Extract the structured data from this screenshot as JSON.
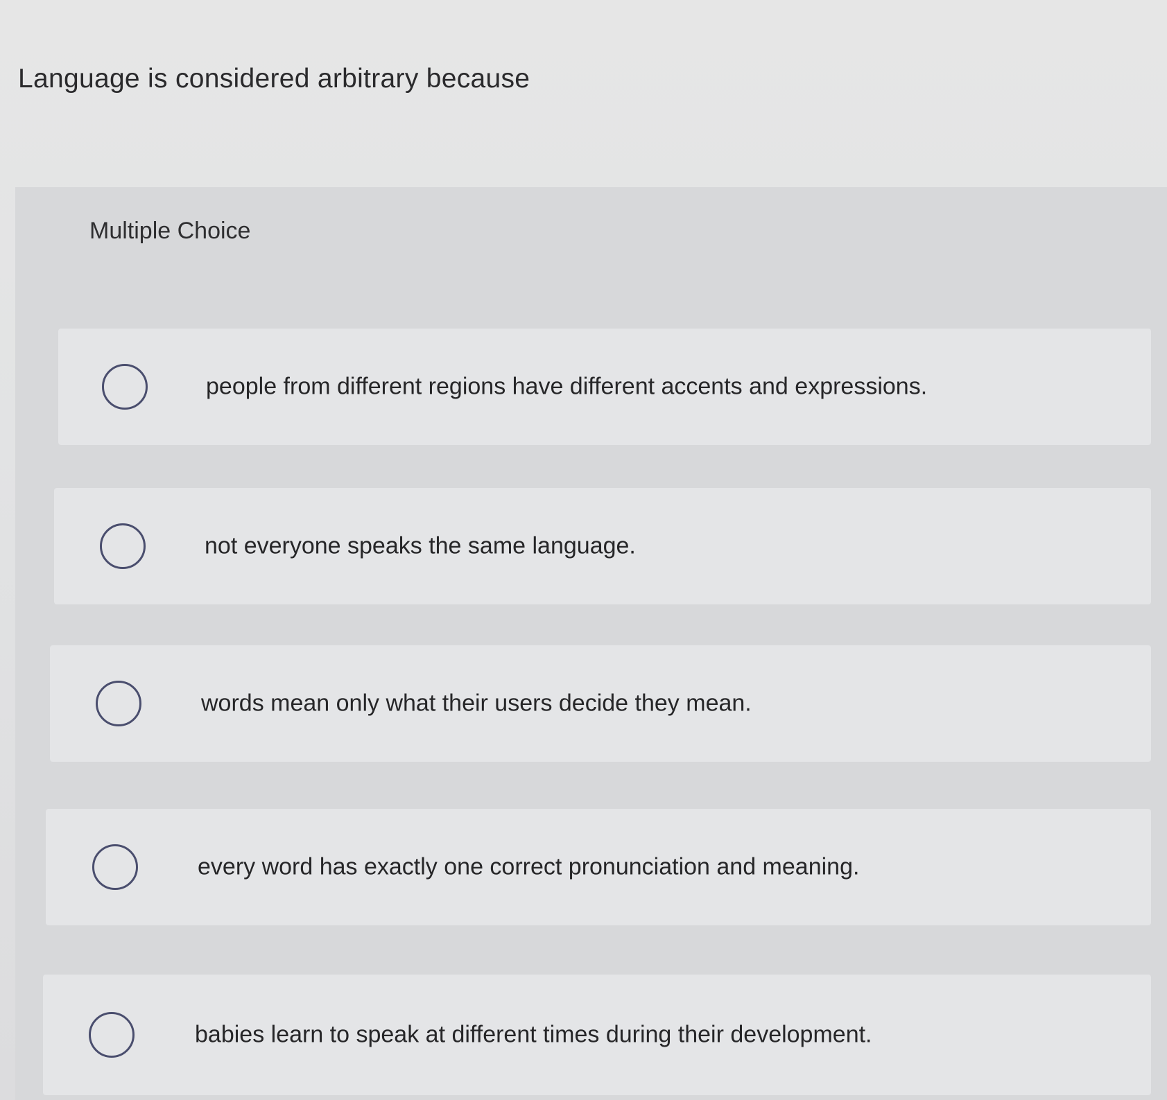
{
  "question": {
    "text": "Language is considered arbitrary because"
  },
  "panel": {
    "label": "Multiple Choice"
  },
  "options": [
    {
      "text": "people from different regions have different accents and expressions."
    },
    {
      "text": "not everyone speaks the same language."
    },
    {
      "text": "words mean only what their users decide they mean."
    },
    {
      "text": "every word has exactly one correct pronunciation and meaning."
    },
    {
      "text": "babies learn to speak at different times during their development."
    }
  ]
}
